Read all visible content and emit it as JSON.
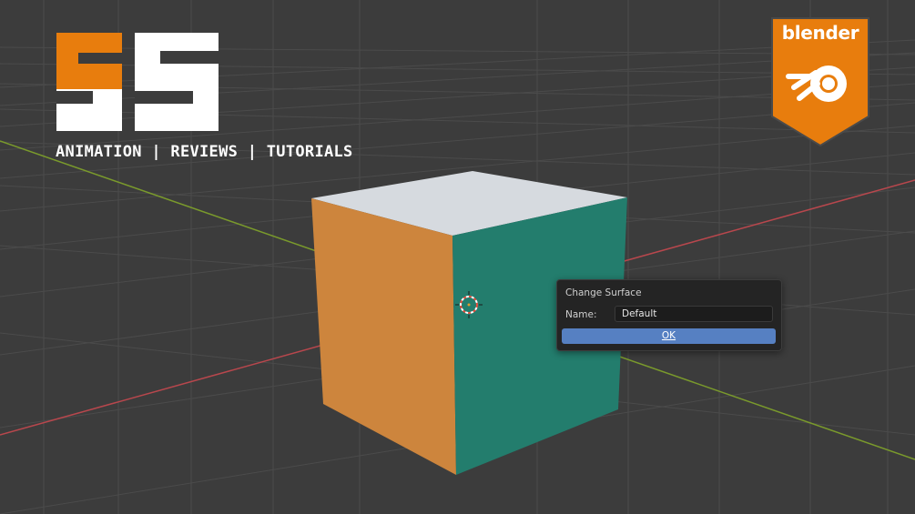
{
  "overlay": {
    "tagline": "ANIMATION | REVIEWS | TUTORIALS",
    "brand_badge": "blender"
  },
  "dialog": {
    "title": "Change Surface",
    "name_label": "Name:",
    "name_value": "Default",
    "ok_label": "OK"
  },
  "icons": {
    "channel_logo": "fs-logo",
    "blender_logo": "blender-logo-icon",
    "cursor": "3d-cursor-icon"
  },
  "colors": {
    "viewport_bg": "#3c3c3c",
    "grid_line": "#4b4b4b",
    "x_axis": "#b8474d",
    "y_axis": "#7a9a2c",
    "cube_top": "#d6dadf",
    "cube_left": "#cd853d",
    "cube_right": "#237d6d",
    "logo_orange": "#e87d0d",
    "logo_white": "#ffffff",
    "dialog_bg": "#242424",
    "button_blue": "#5680c2"
  }
}
